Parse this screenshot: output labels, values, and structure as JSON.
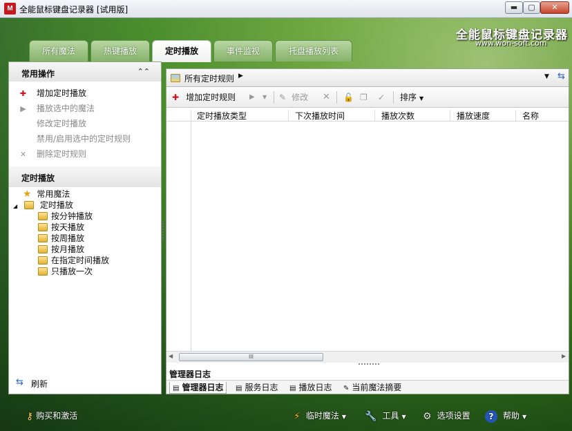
{
  "window": {
    "app_icon": "M",
    "title": "全能鼠标键盘记录器 [试用版]",
    "min_glyph": "▬",
    "max_glyph": "▢",
    "close_glyph": "✕"
  },
  "brand": {
    "name": "全能鼠标键盘记录器",
    "url": "www.won-soft.com"
  },
  "tabs": [
    {
      "label": "所有魔法"
    },
    {
      "label": "热键播放"
    },
    {
      "label": "定时播放",
      "active": true
    },
    {
      "label": "事件监视"
    },
    {
      "label": "托盘播放列表"
    }
  ],
  "left": {
    "ops_title": "常用操作",
    "collapse_icon": "⌃⌃",
    "ops": [
      {
        "label": "增加定时播放",
        "icon": "add-schedule-icon",
        "enabled": true
      },
      {
        "label": "播放选中的魔法",
        "icon": "play-icon",
        "enabled": false
      },
      {
        "label": "修改定时播放",
        "icon": "",
        "enabled": false
      },
      {
        "label": "禁用/启用选中的定时规则",
        "icon": "",
        "enabled": false
      },
      {
        "label": "删除定时规则",
        "icon": "delete-icon",
        "enabled": false
      }
    ],
    "tree_title": "定时播放",
    "tree": {
      "favorites": "常用魔法",
      "root": "定时播放",
      "children": [
        "按分钟播放",
        "按天播放",
        "按周播放",
        "按月播放",
        "在指定时间播放",
        "只播放一次"
      ]
    },
    "refresh": "刷新"
  },
  "main": {
    "address": "所有定时规则",
    "toolbar": {
      "add": "增加定时规则",
      "edit": "修改",
      "sort": "排序"
    },
    "columns": [
      "定时播放类型",
      "下次播放时间",
      "播放次数",
      "播放速度",
      "名称"
    ],
    "scroll_thumb": "III",
    "log_title": "管理器日志",
    "log_tabs": [
      "管理器日志",
      "服务日志",
      "播放日志",
      "当前魔法摘要"
    ]
  },
  "bottom": {
    "buy": "购买和激活",
    "temp_magic": "临时魔法",
    "tools": "工具",
    "options": "选项设置",
    "help": "帮助"
  },
  "colors": {
    "accent_green": "#3f8a1f",
    "tab_active": "#ffffff",
    "close_red": "#c7452d"
  }
}
